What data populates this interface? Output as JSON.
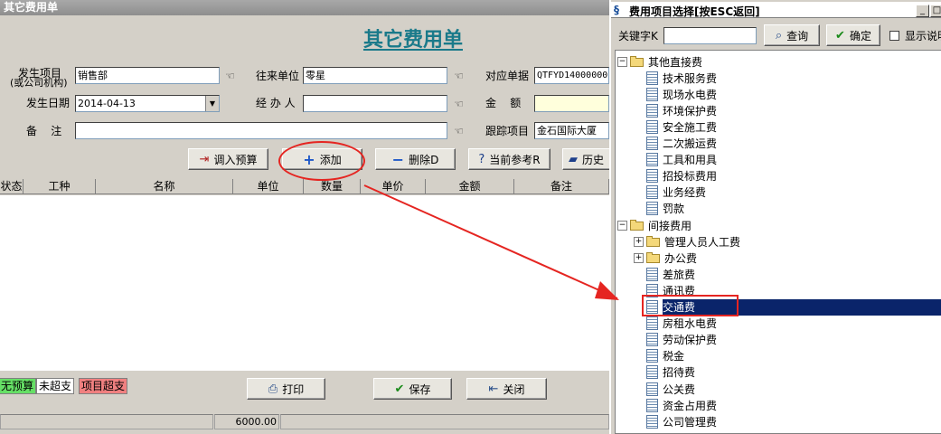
{
  "main": {
    "window_title": "其它费用单",
    "form_title": "其它费用单",
    "fields": {
      "item_label_1": "发生项目",
      "item_label_2": "(或公司机构)",
      "item_value": "销售部",
      "partner_label": "往来单位",
      "partner_value": "零星",
      "ref_label": "对应单据",
      "ref_value": "QTFYD14000000",
      "date_label": "发生日期",
      "date_value": "2014-04-13",
      "handler_label": "经 办 人",
      "handler_value": "",
      "amount_label": "金    额",
      "amount_value": "",
      "note_label": "备    注",
      "note_value": "",
      "track_label": "跟踪项目",
      "track_value": "金石国际大厦"
    },
    "buttons": {
      "import_budget": "调入预算",
      "add": "添加",
      "delete": "删除D",
      "current_ref": "当前参考R",
      "history": "历史",
      "print": "打印",
      "save": "保存",
      "close": "关闭"
    },
    "grid_columns": [
      "状态",
      "工种",
      "名称",
      "单位",
      "数量",
      "单价",
      "金额",
      "备注"
    ],
    "legend": [
      "无预算",
      "未超支",
      "项目超支"
    ],
    "status_total": "6000.00"
  },
  "dialog": {
    "title": "费用项目选择[按ESC返回]",
    "keyword_label": "关键字K",
    "keyword_value": "",
    "query_button": "查询",
    "ok_button": "确定",
    "show_desc_label": "显示说明",
    "tree": [
      {
        "label": "其他直接费",
        "type": "folder",
        "expanded": true,
        "level": 0
      },
      {
        "label": "技术服务费",
        "type": "leaf",
        "level": 1
      },
      {
        "label": "现场水电费",
        "type": "leaf",
        "level": 1
      },
      {
        "label": "环境保护费",
        "type": "leaf",
        "level": 1
      },
      {
        "label": "安全施工费",
        "type": "leaf",
        "level": 1
      },
      {
        "label": "二次搬运费",
        "type": "leaf",
        "level": 1
      },
      {
        "label": "工具和用具",
        "type": "leaf",
        "level": 1
      },
      {
        "label": "招投标费用",
        "type": "leaf",
        "level": 1
      },
      {
        "label": "业务经费",
        "type": "leaf",
        "level": 1
      },
      {
        "label": "罚款",
        "type": "leaf",
        "level": 1
      },
      {
        "label": "间接费用",
        "type": "folder",
        "expanded": true,
        "level": 0
      },
      {
        "label": "管理人员人工费",
        "type": "folder",
        "expanded": false,
        "level": 1
      },
      {
        "label": "办公费",
        "type": "folder",
        "expanded": false,
        "level": 1
      },
      {
        "label": "差旅费",
        "type": "leaf",
        "level": 1
      },
      {
        "label": "通讯费",
        "type": "leaf",
        "level": 1
      },
      {
        "label": "交通费",
        "type": "leaf",
        "level": 1,
        "selected": true
      },
      {
        "label": "房租水电费",
        "type": "leaf",
        "level": 1
      },
      {
        "label": "劳动保护费",
        "type": "leaf",
        "level": 1
      },
      {
        "label": "税金",
        "type": "leaf",
        "level": 1
      },
      {
        "label": "招待费",
        "type": "leaf",
        "level": 1
      },
      {
        "label": "公关费",
        "type": "leaf",
        "level": 1
      },
      {
        "label": "资金占用费",
        "type": "leaf",
        "level": 1
      },
      {
        "label": "公司管理费",
        "type": "leaf",
        "level": 1
      }
    ]
  },
  "colors": {
    "title_teal": "#1a7a8a",
    "annotation_red": "#e52521",
    "selection_navy": "#0a246a",
    "legend_no_budget": "#66e066",
    "legend_over": "#f08080"
  }
}
